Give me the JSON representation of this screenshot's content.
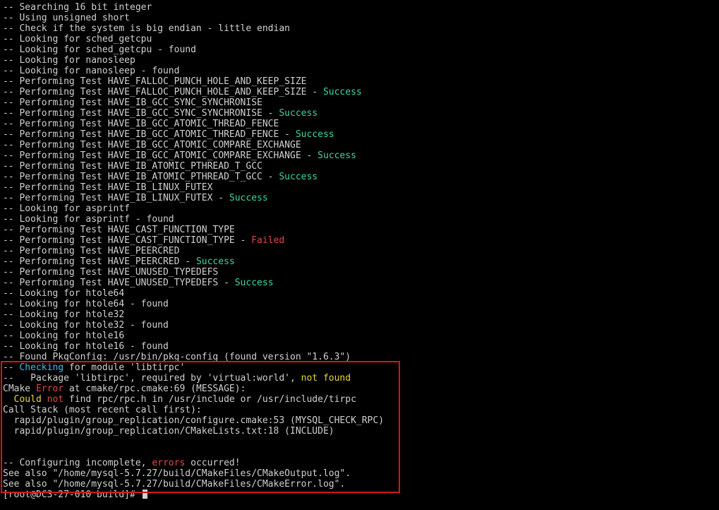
{
  "colors": {
    "default": "#d0d0d0",
    "success": "#3cd7a0",
    "failed": "#e04848",
    "cyan": "#40b8e8",
    "yellow": "#e8d830",
    "error": "#e04848",
    "highlight_border": "#d01818"
  },
  "terminal": {
    "lines": [
      {
        "segments": [
          {
            "text": "-- Searching 16 bit integer",
            "color": "default"
          }
        ]
      },
      {
        "segments": [
          {
            "text": "-- Using unsigned short",
            "color": "default"
          }
        ]
      },
      {
        "segments": [
          {
            "text": "-- Check if the system is big endian - little endian",
            "color": "default"
          }
        ]
      },
      {
        "segments": [
          {
            "text": "-- Looking for sched_getcpu",
            "color": "default"
          }
        ]
      },
      {
        "segments": [
          {
            "text": "-- Looking for sched_getcpu - found",
            "color": "default"
          }
        ]
      },
      {
        "segments": [
          {
            "text": "-- Looking for nanosleep",
            "color": "default"
          }
        ]
      },
      {
        "segments": [
          {
            "text": "-- Looking for nanosleep - found",
            "color": "default"
          }
        ]
      },
      {
        "segments": [
          {
            "text": "-- Performing Test HAVE_FALLOC_PUNCH_HOLE_AND_KEEP_SIZE",
            "color": "default"
          }
        ]
      },
      {
        "segments": [
          {
            "text": "-- Performing Test HAVE_FALLOC_PUNCH_HOLE_AND_KEEP_SIZE - ",
            "color": "default"
          },
          {
            "text": "Success",
            "color": "success"
          }
        ]
      },
      {
        "segments": [
          {
            "text": "-- Performing Test HAVE_IB_GCC_SYNC_SYNCHRONISE",
            "color": "default"
          }
        ]
      },
      {
        "segments": [
          {
            "text": "-- Performing Test HAVE_IB_GCC_SYNC_SYNCHRONISE - ",
            "color": "default"
          },
          {
            "text": "Success",
            "color": "success"
          }
        ]
      },
      {
        "segments": [
          {
            "text": "-- Performing Test HAVE_IB_GCC_ATOMIC_THREAD_FENCE",
            "color": "default"
          }
        ]
      },
      {
        "segments": [
          {
            "text": "-- Performing Test HAVE_IB_GCC_ATOMIC_THREAD_FENCE - ",
            "color": "default"
          },
          {
            "text": "Success",
            "color": "success"
          }
        ]
      },
      {
        "segments": [
          {
            "text": "-- Performing Test HAVE_IB_GCC_ATOMIC_COMPARE_EXCHANGE",
            "color": "default"
          }
        ]
      },
      {
        "segments": [
          {
            "text": "-- Performing Test HAVE_IB_GCC_ATOMIC_COMPARE_EXCHANGE - ",
            "color": "default"
          },
          {
            "text": "Success",
            "color": "success"
          }
        ]
      },
      {
        "segments": [
          {
            "text": "-- Performing Test HAVE_IB_ATOMIC_PTHREAD_T_GCC",
            "color": "default"
          }
        ]
      },
      {
        "segments": [
          {
            "text": "-- Performing Test HAVE_IB_ATOMIC_PTHREAD_T_GCC - ",
            "color": "default"
          },
          {
            "text": "Success",
            "color": "success"
          }
        ]
      },
      {
        "segments": [
          {
            "text": "-- Performing Test HAVE_IB_LINUX_FUTEX",
            "color": "default"
          }
        ]
      },
      {
        "segments": [
          {
            "text": "-- Performing Test HAVE_IB_LINUX_FUTEX - ",
            "color": "default"
          },
          {
            "text": "Success",
            "color": "success"
          }
        ]
      },
      {
        "segments": [
          {
            "text": "-- Looking for asprintf",
            "color": "default"
          }
        ]
      },
      {
        "segments": [
          {
            "text": "-- Looking for asprintf - found",
            "color": "default"
          }
        ]
      },
      {
        "segments": [
          {
            "text": "-- Performing Test HAVE_CAST_FUNCTION_TYPE",
            "color": "default"
          }
        ]
      },
      {
        "segments": [
          {
            "text": "-- Performing Test HAVE_CAST_FUNCTION_TYPE - ",
            "color": "default"
          },
          {
            "text": "Failed",
            "color": "failed"
          }
        ]
      },
      {
        "segments": [
          {
            "text": "-- Performing Test HAVE_PEERCRED",
            "color": "default"
          }
        ]
      },
      {
        "segments": [
          {
            "text": "-- Performing Test HAVE_PEERCRED - ",
            "color": "default"
          },
          {
            "text": "Success",
            "color": "success"
          }
        ]
      },
      {
        "segments": [
          {
            "text": "-- Performing Test HAVE_UNUSED_TYPEDEFS",
            "color": "default"
          }
        ]
      },
      {
        "segments": [
          {
            "text": "-- Performing Test HAVE_UNUSED_TYPEDEFS - ",
            "color": "default"
          },
          {
            "text": "Success",
            "color": "success"
          }
        ]
      },
      {
        "segments": [
          {
            "text": "-- Looking for htole64",
            "color": "default"
          }
        ]
      },
      {
        "segments": [
          {
            "text": "-- Looking for htole64 - found",
            "color": "default"
          }
        ]
      },
      {
        "segments": [
          {
            "text": "-- Looking for htole32",
            "color": "default"
          }
        ]
      },
      {
        "segments": [
          {
            "text": "-- Looking for htole32 - found",
            "color": "default"
          }
        ]
      },
      {
        "segments": [
          {
            "text": "-- Looking for htole16",
            "color": "default"
          }
        ]
      },
      {
        "segments": [
          {
            "text": "-- Looking for htole16 - found",
            "color": "default"
          }
        ]
      },
      {
        "segments": [
          {
            "text": "-- Found PkgConfig: /usr/bin/pkg-config (found version \"1.6.3\")",
            "color": "default"
          }
        ]
      },
      {
        "segments": [
          {
            "text": "-- ",
            "color": "default"
          },
          {
            "text": "Checking",
            "color": "cyan"
          },
          {
            "text": " for module 'libtirpc'",
            "color": "default"
          }
        ]
      },
      {
        "segments": [
          {
            "text": "--   Package 'libtirpc', required by 'virtual:world', ",
            "color": "default"
          },
          {
            "text": "not found",
            "color": "yellow"
          }
        ]
      },
      {
        "segments": [
          {
            "text": "CMake ",
            "color": "default"
          },
          {
            "text": "Error",
            "color": "error"
          },
          {
            "text": " at cmake/rpc.cmake:69 (MESSAGE):",
            "color": "default"
          }
        ]
      },
      {
        "segments": [
          {
            "text": "  Could ",
            "color": "yellow"
          },
          {
            "text": "not",
            "color": "error"
          },
          {
            "text": " find rpc/rpc.h in /usr/include or /usr/include/tirpc",
            "color": "default"
          }
        ]
      },
      {
        "segments": [
          {
            "text": "Call Stack (most recent call first):",
            "color": "default"
          }
        ]
      },
      {
        "segments": [
          {
            "text": "  rapid/plugin/group_replication/configure.cmake:53 (MYSQL_CHECK_RPC)",
            "color": "default"
          }
        ]
      },
      {
        "segments": [
          {
            "text": "  rapid/plugin/group_replication/CMakeLists.txt:18 (INCLUDE)",
            "color": "default"
          }
        ]
      },
      {
        "segments": [
          {
            "text": "",
            "color": "default"
          }
        ]
      },
      {
        "segments": [
          {
            "text": "",
            "color": "default"
          }
        ]
      },
      {
        "segments": [
          {
            "text": "-- Configuring incomplete, ",
            "color": "default"
          },
          {
            "text": "errors",
            "color": "error"
          },
          {
            "text": " occurred!",
            "color": "default"
          }
        ]
      },
      {
        "segments": [
          {
            "text": "See also \"/home/mysql-5.7.27/build/CMakeFiles/CMakeOutput.log\".",
            "color": "default"
          }
        ]
      },
      {
        "segments": [
          {
            "text": "See also \"/home/mysql-5.7.27/build/CMakeFiles/CMakeError.log\".",
            "color": "default"
          }
        ]
      }
    ],
    "prompt": "[root@DC3-27-010 build]# "
  }
}
